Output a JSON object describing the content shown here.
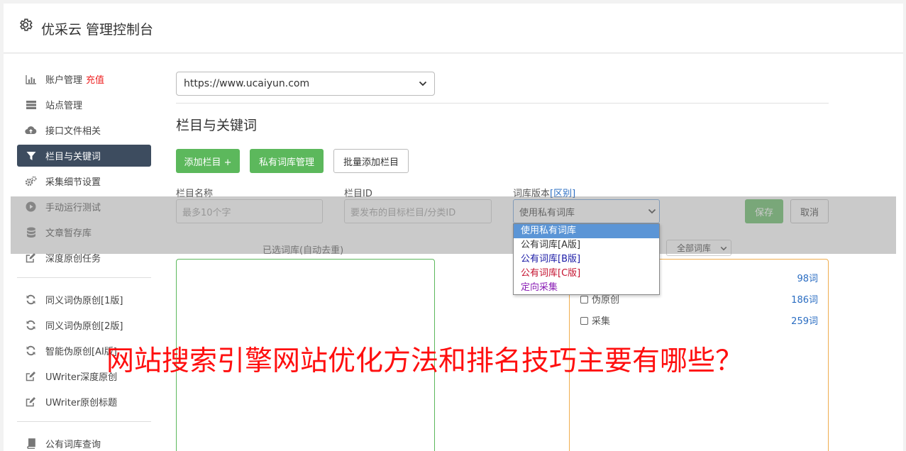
{
  "header": {
    "title": "优采云 管理控制台",
    "icon": "gear-icon"
  },
  "sidebar": {
    "group1": [
      {
        "label": "账户管理",
        "badge": "充值",
        "icon": "bar-chart-icon"
      },
      {
        "label": "站点管理",
        "icon": "server-icon"
      },
      {
        "label": "接口文件相关",
        "icon": "cloud-upload-icon"
      },
      {
        "label": "栏目与关键词",
        "icon": "filter-icon",
        "active": true
      },
      {
        "label": "采集细节设置",
        "icon": "cogs-icon"
      },
      {
        "label": "手动运行测试",
        "icon": "play-circle-icon"
      },
      {
        "label": "文章暂存库",
        "icon": "database-icon"
      },
      {
        "label": "深度原创任务",
        "icon": "edit-icon"
      }
    ],
    "group2": [
      {
        "label": "同义词伪原创[1版]",
        "icon": "refresh-icon"
      },
      {
        "label": "同义词伪原创[2版]",
        "icon": "refresh-icon"
      },
      {
        "label": "智能伪原创[AI版]",
        "icon": "refresh-icon"
      },
      {
        "label": "UWriter深度原创",
        "icon": "edit-icon"
      },
      {
        "label": "UWriter原创标题",
        "icon": "edit-icon"
      }
    ],
    "group3": [
      {
        "label": "公有词库查询",
        "icon": "book-icon"
      }
    ]
  },
  "content": {
    "site_select": "https://www.ucaiyun.com",
    "section_title": "栏目与关键词",
    "buttons": {
      "add_column": "添加栏目 +",
      "private_lib": "私有词库管理",
      "batch_add": "批量添加栏目"
    },
    "form": {
      "name_label": "栏目名称",
      "name_placeholder": "最多10个字",
      "id_label": "栏目ID",
      "id_placeholder": "要发布的目标栏目/分类ID",
      "version_label": "词库版本",
      "version_link": "[区别]",
      "version_value": "使用私有词库",
      "save": "保存",
      "cancel": "取消"
    },
    "selected_lib_label": "已选词库(自动去重)",
    "all_lib_select": "全部词库",
    "dropdown_options": [
      {
        "label": "使用私有词库",
        "color": "#ffffff"
      },
      {
        "label": "公有词库[A版]",
        "color": "#333333"
      },
      {
        "label": "公有词库[B版]",
        "color": "#1a1aa6"
      },
      {
        "label": "公有词库[C版]",
        "color": "#c4122f"
      },
      {
        "label": "定向采集",
        "color": "#8a1fb5"
      }
    ],
    "libs": [
      {
        "label": "",
        "count": "98词"
      },
      {
        "label": "伪原创",
        "count": "186词"
      },
      {
        "label": "采集",
        "count": "259词"
      }
    ]
  },
  "banner": "网站搜索引擎网站优化方法和排名技巧主要有哪些？",
  "colors": {
    "primary_green": "#5cb85c",
    "active_nav": "#3d4c5f",
    "link_blue": "#2a6dc2",
    "banner_red": "#ff0f0f"
  }
}
